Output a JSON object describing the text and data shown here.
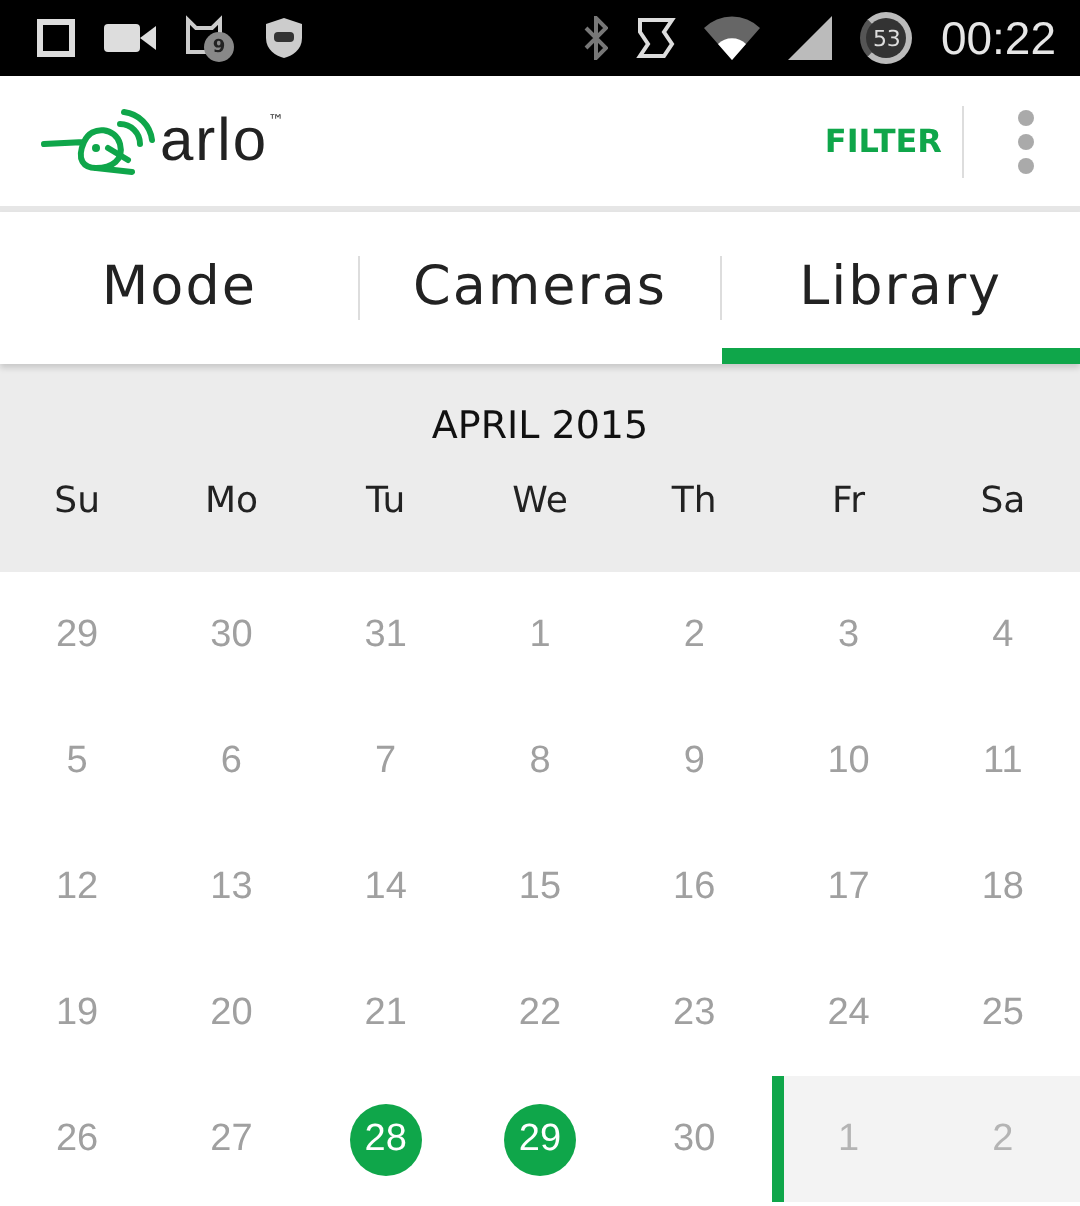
{
  "status_bar": {
    "notification_count": "9",
    "battery": "53",
    "time": "00:22"
  },
  "header": {
    "logo_text": "arlo",
    "trademark": "™",
    "filter_button": "FILTER"
  },
  "tabs": [
    {
      "label": "Mode",
      "selected": false
    },
    {
      "label": "Cameras",
      "selected": false
    },
    {
      "label": "Library",
      "selected": true
    }
  ],
  "calendar": {
    "title": "APRIL 2015",
    "weekdays": [
      "Su",
      "Mo",
      "Tu",
      "We",
      "Th",
      "Fr",
      "Sa"
    ],
    "weeks": [
      [
        {
          "label": "29",
          "kind": "day",
          "selected": false
        },
        {
          "label": "30",
          "kind": "day",
          "selected": false
        },
        {
          "label": "31",
          "kind": "day",
          "selected": false
        },
        {
          "label": "1",
          "kind": "day",
          "selected": false
        },
        {
          "label": "2",
          "kind": "day",
          "selected": false
        },
        {
          "label": "3",
          "kind": "day",
          "selected": false
        },
        {
          "label": "4",
          "kind": "day",
          "selected": false
        }
      ],
      [
        {
          "label": "5",
          "kind": "day",
          "selected": false
        },
        {
          "label": "6",
          "kind": "day",
          "selected": false
        },
        {
          "label": "7",
          "kind": "day",
          "selected": false
        },
        {
          "label": "8",
          "kind": "day",
          "selected": false
        },
        {
          "label": "9",
          "kind": "day",
          "selected": false
        },
        {
          "label": "10",
          "kind": "day",
          "selected": false
        },
        {
          "label": "11",
          "kind": "day",
          "selected": false
        }
      ],
      [
        {
          "label": "12",
          "kind": "day",
          "selected": false
        },
        {
          "label": "13",
          "kind": "day",
          "selected": false
        },
        {
          "label": "14",
          "kind": "day",
          "selected": false
        },
        {
          "label": "15",
          "kind": "day",
          "selected": false
        },
        {
          "label": "16",
          "kind": "day",
          "selected": false
        },
        {
          "label": "17",
          "kind": "day",
          "selected": false
        },
        {
          "label": "18",
          "kind": "day",
          "selected": false
        }
      ],
      [
        {
          "label": "19",
          "kind": "day",
          "selected": false
        },
        {
          "label": "20",
          "kind": "day",
          "selected": false
        },
        {
          "label": "21",
          "kind": "day",
          "selected": false
        },
        {
          "label": "22",
          "kind": "day",
          "selected": false
        },
        {
          "label": "23",
          "kind": "day",
          "selected": false
        },
        {
          "label": "24",
          "kind": "day",
          "selected": false
        },
        {
          "label": "25",
          "kind": "day",
          "selected": false
        }
      ],
      [
        {
          "label": "26",
          "kind": "day",
          "selected": false
        },
        {
          "label": "27",
          "kind": "day",
          "selected": false
        },
        {
          "label": "28",
          "kind": "day",
          "selected": true
        },
        {
          "label": "29",
          "kind": "day",
          "selected": true
        },
        {
          "label": "30",
          "kind": "day",
          "selected": false
        },
        {
          "label": "1",
          "kind": "future",
          "selected": false
        },
        {
          "label": "2",
          "kind": "future",
          "selected": false
        }
      ]
    ]
  }
}
